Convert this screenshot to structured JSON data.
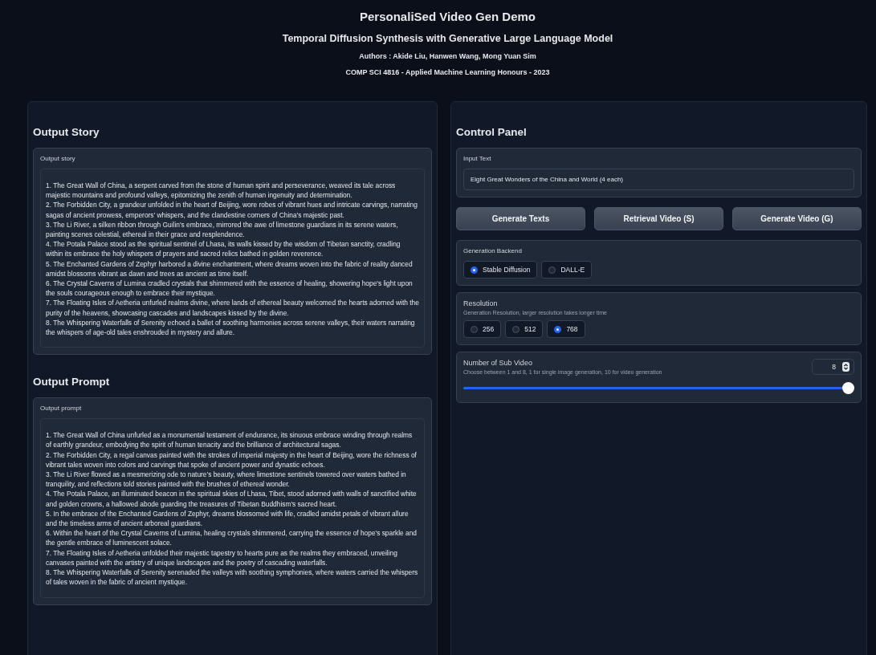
{
  "header": {
    "title": "PersonaliSed Video Gen Demo",
    "subtitle": "Temporal Diffusion Synthesis with Generative Large Language Model",
    "authors": "Authors : Akide Liu, Hanwen Wang, Mong Yuan Sim",
    "course": "COMP SCI 4816 - Applied Machine Learning Honours - 2023"
  },
  "output_story": {
    "heading": "Output Story",
    "label": "Output story",
    "items": [
      "1. The Great Wall of China, a serpent carved from the stone of human spirit and perseverance, weaved its tale across majestic mountains and profound valleys, epitomizing the zenith of human ingenuity and determination.",
      "2. The Forbidden City, a grandeur unfolded in the heart of Beijing, wore robes of vibrant hues and intricate carvings, narrating sagas of ancient prowess, emperors' whispers, and the clandestine corners of China's majestic past.",
      "3. The Li River, a silken ribbon through Guilin's embrace, mirrored the awe of limestone guardians in its serene waters, painting scenes celestial, ethereal in their grace and resplendence.",
      "4. The Potala Palace stood as the spiritual sentinel of Lhasa, its walls kissed by the wisdom of Tibetan sanctity, cradling within its embrace the holy whispers of prayers and sacred relics bathed in golden reverence.",
      "5. The Enchanted Gardens of Zephyr harbored a divine enchantment, where dreams woven into the fabric of reality danced amidst blossoms vibrant as dawn and trees as ancient as time itself.",
      "6. The Crystal Caverns of Lumina cradled crystals that shimmered with the essence of healing, showering hope's light upon the souls courageous enough to embrace their mystique.",
      "7. The Floating Isles of Aetheria unfurled realms divine, where lands of ethereal beauty welcomed the hearts adorned with the purity of the heavens, showcasing cascades and landscapes kissed by the divine.",
      "8. The Whispering Waterfalls of Serenity echoed a ballet of soothing harmonies across serene valleys, their waters narrating the whispers of age-old tales enshrouded in mystery and allure."
    ]
  },
  "output_prompt": {
    "heading": "Output Prompt",
    "label": "Output prompt",
    "items": [
      "1. The Great Wall of China unfurled as a monumental testament of endurance, its sinuous embrace winding through realms of earthly grandeur, embodying the spirit of human tenacity and the brilliance of architectural sagas.",
      "2. The Forbidden City, a regal canvas painted with the strokes of imperial majesty in the heart of Beijing, wore the richness of vibrant tales woven into colors and carvings that spoke of ancient power and dynastic echoes.",
      "3. The Li River flowed as a mesmerizing ode to nature’s beauty, where limestone sentinels towered over waters bathed in tranquility, and reflections told stories painted with the brushes of ethereal wonder.",
      "4. The Potala Palace, an illuminated beacon in the spiritual skies of Lhasa, Tibet, stood adorned with walls of sanctified white and golden crowns, a hallowed abode guarding the treasures of Tibetan Buddhism's sacred heart.",
      "5. In the embrace of the Enchanted Gardens of Zephyr, dreams blossomed with life, cradled amidst petals of vibrant allure and the timeless arms of ancient arboreal guardians.",
      "6. Within the heart of the Crystal Caverns of Lumina, healing crystals shimmered, carrying the essence of hope's sparkle and the gentle embrace of luminescent solace.",
      "7. The Floating Isles of Aetheria unfolded their majestic tapestry to hearts pure as the realms they embraced, unveiling canvases painted with the artistry of unique landscapes and the poetry of cascading waterfalls.",
      "8. The Whispering Waterfalls of Serenity serenaded the valleys with soothing symphonies, where waters carried the whispers of tales woven in the fabric of ancient mystique."
    ]
  },
  "control_panel": {
    "heading": "Control Panel",
    "input": {
      "label": "Input Text",
      "value": "Eight Great Wonders of the China and World (4 each)"
    },
    "buttons": [
      "Generate Texts",
      "Retrieval Video (S)",
      "Generate Video (G)"
    ],
    "backend": {
      "label": "Generation Backend",
      "options": [
        {
          "label": "Stable Diffusion",
          "selected": true
        },
        {
          "label": "DALL-E",
          "selected": false
        }
      ]
    },
    "resolution": {
      "label": "Resolution",
      "info": "Generation Resolution, larger resolution takes longer time",
      "options": [
        {
          "label": "256",
          "selected": false
        },
        {
          "label": "512",
          "selected": false
        },
        {
          "label": "768",
          "selected": true
        }
      ]
    },
    "sub_video": {
      "label": "Number of Sub Video",
      "info": "Choose between 1 and 8, 1 for single image generation, 10 for video generation",
      "value": "8",
      "level": 1
    }
  }
}
